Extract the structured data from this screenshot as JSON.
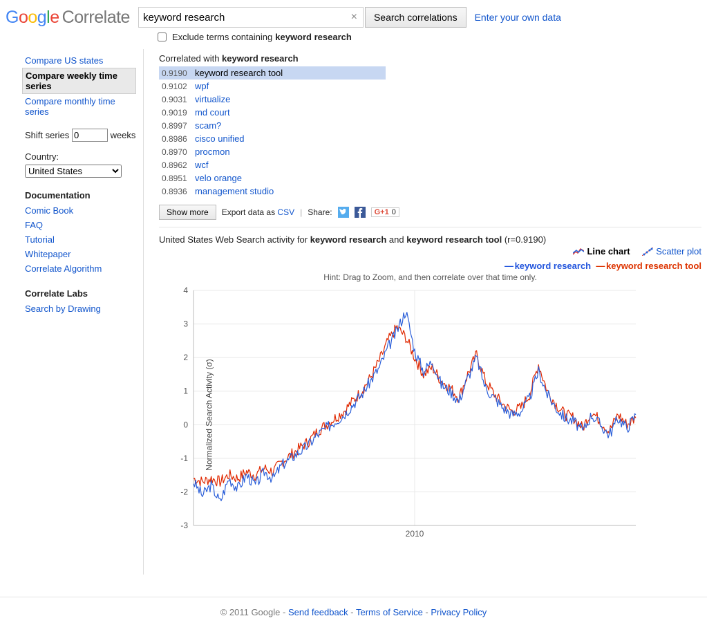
{
  "logo_text": "Correlate",
  "search": {
    "value": "keyword research",
    "button": "Search correlations",
    "own_data": "Enter your own data"
  },
  "exclude": {
    "label_prefix": "Exclude terms containing ",
    "term": "keyword research"
  },
  "sidebar": {
    "nav": [
      {
        "label": "Compare US states",
        "active": false
      },
      {
        "label": "Compare weekly time series",
        "active": true
      },
      {
        "label": "Compare monthly time series",
        "active": false
      }
    ],
    "shift_label_pre": "Shift series",
    "shift_value": "0",
    "shift_label_post": "weeks",
    "country_label": "Country:",
    "country_value": "United States",
    "doc_heading": "Documentation",
    "doc_links": [
      "Comic Book",
      "FAQ",
      "Tutorial",
      "Whitepaper",
      "Correlate Algorithm"
    ],
    "labs_heading": "Correlate Labs",
    "labs_links": [
      "Search by Drawing"
    ]
  },
  "results_heading": {
    "pre": "Correlated with ",
    "term": "keyword research"
  },
  "results": [
    {
      "coef": "0.9190",
      "term": "keyword research tool",
      "selected": true
    },
    {
      "coef": "0.9102",
      "term": "wpf"
    },
    {
      "coef": "0.9031",
      "term": "virtualize"
    },
    {
      "coef": "0.9019",
      "term": "md court"
    },
    {
      "coef": "0.8997",
      "term": "scam?"
    },
    {
      "coef": "0.8986",
      "term": "cisco unified"
    },
    {
      "coef": "0.8970",
      "term": "procmon"
    },
    {
      "coef": "0.8962",
      "term": "wcf"
    },
    {
      "coef": "0.8951",
      "term": "velo orange"
    },
    {
      "coef": "0.8936",
      "term": "management studio"
    }
  ],
  "toolbar": {
    "show_more": "Show more",
    "export_pre": "Export data as ",
    "export_link": "CSV",
    "share": "Share:",
    "gplus_count": "0"
  },
  "chart_desc": {
    "pre": "United States Web Search activity for ",
    "term1": "keyword research",
    "mid": " and ",
    "term2": "keyword research tool",
    "r": " (r=0.9190)"
  },
  "chart_tabs": {
    "line": "Line chart",
    "scatter": "Scatter plot"
  },
  "legend": {
    "s1": "keyword research",
    "s2": "keyword research tool"
  },
  "hint": "Hint: Drag to Zoom, and then correlate over that time only.",
  "footer": {
    "copyright": "© 2011 Google",
    "feedback": "Send feedback",
    "tos": "Terms of Service",
    "privacy": "Privacy Policy"
  },
  "chart_data": {
    "type": "line",
    "title": "",
    "xlabel": "",
    "ylabel": "Normalized Search Activity (σ)",
    "ylim": [
      -3,
      4
    ],
    "yticks": [
      -3,
      -2,
      -1,
      0,
      1,
      2,
      3,
      4
    ],
    "xticks": [
      {
        "pos": 0.5,
        "label": "2010"
      }
    ],
    "series": [
      {
        "name": "keyword research",
        "color": "#2b5fd9"
      },
      {
        "name": "keyword research tool",
        "color": "#e02800"
      }
    ],
    "note": "Weekly values ~2004–2016; series rise from ≈ -1.8σ through 2007, peak near 3–3.5σ around 2009, then oscillate 0–1σ thereafter. Values below are visual estimates at ~50 sample points across the x-range.",
    "x_fraction": [
      0.0,
      0.02,
      0.04,
      0.06,
      0.08,
      0.1,
      0.12,
      0.14,
      0.16,
      0.18,
      0.2,
      0.22,
      0.24,
      0.26,
      0.28,
      0.3,
      0.32,
      0.34,
      0.36,
      0.38,
      0.4,
      0.42,
      0.44,
      0.46,
      0.48,
      0.5,
      0.52,
      0.54,
      0.56,
      0.58,
      0.6,
      0.62,
      0.64,
      0.66,
      0.68,
      0.7,
      0.72,
      0.74,
      0.76,
      0.78,
      0.8,
      0.82,
      0.84,
      0.86,
      0.88,
      0.9,
      0.92,
      0.94,
      0.96,
      0.98,
      1.0
    ],
    "values": {
      "keyword research": [
        -1.7,
        -2.1,
        -1.8,
        -2.3,
        -1.6,
        -1.9,
        -1.5,
        -1.8,
        -1.4,
        -1.6,
        -1.2,
        -1.0,
        -0.8,
        -0.6,
        -0.3,
        -0.1,
        0.1,
        0.3,
        0.6,
        0.9,
        1.3,
        1.7,
        2.3,
        2.8,
        3.4,
        2.2,
        1.6,
        1.9,
        1.2,
        1.0,
        0.7,
        1.4,
        2.0,
        1.1,
        0.8,
        0.5,
        0.3,
        0.4,
        0.8,
        1.6,
        0.9,
        0.5,
        0.2,
        0.1,
        -0.2,
        0.3,
        0.0,
        -0.3,
        0.2,
        -0.1,
        0.3
      ],
      "keyword research tool": [
        -1.6,
        -1.7,
        -1.6,
        -1.7,
        -1.5,
        -1.6,
        -1.4,
        -1.5,
        -1.3,
        -1.4,
        -1.1,
        -0.9,
        -0.7,
        -0.5,
        -0.2,
        0.0,
        0.2,
        0.4,
        0.7,
        1.0,
        1.4,
        1.9,
        2.5,
        2.9,
        2.6,
        2.0,
        1.5,
        1.7,
        1.3,
        1.1,
        0.8,
        1.5,
        2.1,
        1.3,
        0.9,
        0.6,
        0.4,
        0.5,
        0.9,
        1.8,
        1.0,
        0.6,
        0.3,
        0.2,
        -0.1,
        0.4,
        0.1,
        -0.2,
        0.3,
        0.0,
        0.2
      ]
    }
  }
}
